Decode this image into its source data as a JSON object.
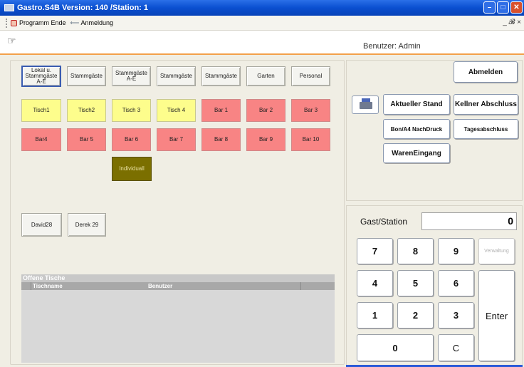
{
  "window": {
    "title": "Gastro.S4B Version:  140 /Station: 1",
    "controls": [
      "minimize",
      "maximize",
      "close"
    ],
    "mdi_controls": "_ &#x2153; ×"
  },
  "menu": {
    "items": [
      {
        "label": "Programm Ende",
        "icon": "exit-icon"
      },
      {
        "label": "Anmeldung",
        "icon": "arrow-icon"
      }
    ]
  },
  "header": {
    "user": "Benutzer: Admin"
  },
  "area_tabs": [
    {
      "label": "Lokal u. Stammgäste A-E",
      "selected": true
    },
    {
      "label": "Stammgäste",
      "selected": false
    },
    {
      "label": "Stammgäste A-E",
      "selected": false
    },
    {
      "label": "Stammgäste",
      "selected": false
    },
    {
      "label": "Stammgäste",
      "selected": false
    },
    {
      "label": "Garten",
      "selected": false
    },
    {
      "label": "Personal",
      "selected": false
    }
  ],
  "tables": [
    {
      "label": "Tisch1",
      "status": "yellow"
    },
    {
      "label": "Tisch2",
      "status": "yellow"
    },
    {
      "label": "Tisch 3",
      "status": "yellow"
    },
    {
      "label": "Tisch 4",
      "status": "yellow"
    },
    {
      "label": "Bar 1",
      "status": "red"
    },
    {
      "label": "Bar 2",
      "status": "red"
    },
    {
      "label": "Bar 3",
      "status": "red"
    },
    {
      "label": "Bar4",
      "status": "red"
    },
    {
      "label": "Bar 5",
      "status": "red"
    },
    {
      "label": "Bar 6",
      "status": "red"
    },
    {
      "label": "Bar 7",
      "status": "red"
    },
    {
      "label": "Bar 8",
      "status": "red"
    },
    {
      "label": "Bar 9",
      "status": "red"
    },
    {
      "label": "Bar 10",
      "status": "red"
    },
    {
      "label": "Individuall",
      "status": "olive"
    }
  ],
  "guests": [
    {
      "label": "David28"
    },
    {
      "label": "Derek  29"
    }
  ],
  "open_tables": {
    "title": "Offene Tische",
    "columns": [
      "Tischname",
      "Benutzer"
    ],
    "rows": []
  },
  "actions": {
    "logout": "Abmelden",
    "current_status": "Aktueller Stand",
    "waiter_close": "Kellner Abschluss",
    "reprint": "Bon/A4 NachDruck",
    "day_close": "Tagesabschluss",
    "goods_in": "WarenEingang"
  },
  "numpad": {
    "label": "Gast/Station",
    "value": "0",
    "keys": [
      "7",
      "8",
      "9",
      "Verwaltung",
      "4",
      "5",
      "6",
      "1",
      "2",
      "3",
      "Enter",
      "0",
      "C"
    ]
  },
  "colors": {
    "title_bar": "#0a4fd0",
    "yellow_table": "#fdfd8c",
    "red_table": "#f88484",
    "olive_table": "#7b6f00",
    "header_underline": "#f3a04a"
  }
}
